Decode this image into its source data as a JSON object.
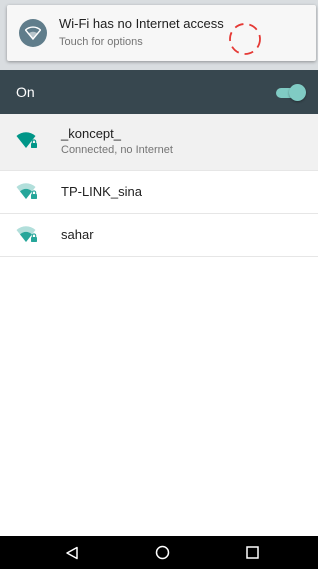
{
  "notification": {
    "title": "Wi-Fi has no Internet access",
    "subtitle": "Touch for options",
    "icon": "wifi-icon"
  },
  "wifi_switch": {
    "label": "On",
    "state": "on",
    "accent": "#80cbc4"
  },
  "networks": [
    {
      "ssid": "_koncept_",
      "status": "Connected, no Internet",
      "secured": true,
      "icon_color": "#009688"
    },
    {
      "ssid": "TP-LINK_sina",
      "status": "",
      "secured": true,
      "icon_color": "#26a69a"
    },
    {
      "ssid": "sahar",
      "status": "",
      "secured": true,
      "icon_color": "#26a69a"
    }
  ],
  "navbar": {
    "buttons": [
      "back-icon",
      "home-icon",
      "recents-icon"
    ]
  },
  "colors": {
    "toolbar": "#37474f",
    "notification_icon_bg": "#607d8b",
    "annotation": "#e53935"
  }
}
